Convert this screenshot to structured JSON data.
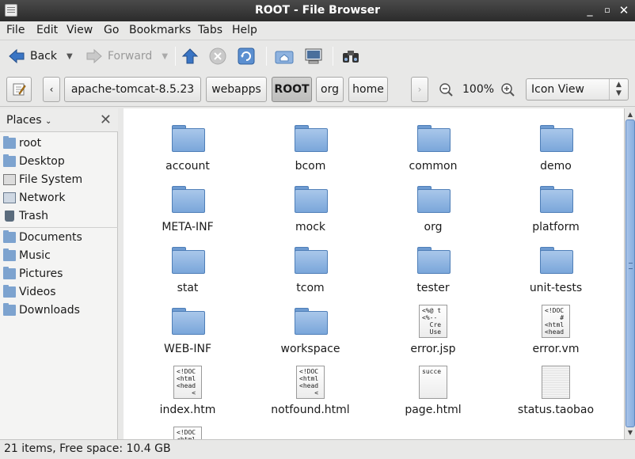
{
  "window": {
    "title": "ROOT - File Browser"
  },
  "menu": [
    "File",
    "Edit",
    "View",
    "Go",
    "Bookmarks",
    "Tabs",
    "Help"
  ],
  "toolbar": {
    "back": "Back",
    "forward": "Forward"
  },
  "path": {
    "segments": [
      "apache-tomcat-8.5.23",
      "webapps",
      "ROOT",
      "org",
      "home"
    ],
    "active": "ROOT"
  },
  "zoom": "100%",
  "view_mode": "Icon View",
  "sidebar": {
    "header": "Places",
    "items": [
      {
        "label": "root",
        "icon": "home-folder-icon"
      },
      {
        "label": "Desktop",
        "icon": "desktop-folder-icon"
      },
      {
        "label": "File System",
        "icon": "drive-icon"
      },
      {
        "label": "Network",
        "icon": "network-icon"
      },
      {
        "label": "Trash",
        "icon": "trash-icon"
      },
      {
        "label": "Documents",
        "icon": "documents-folder-icon"
      },
      {
        "label": "Music",
        "icon": "music-folder-icon"
      },
      {
        "label": "Pictures",
        "icon": "pictures-folder-icon"
      },
      {
        "label": "Videos",
        "icon": "videos-folder-icon"
      },
      {
        "label": "Downloads",
        "icon": "downloads-folder-icon"
      }
    ]
  },
  "files": [
    {
      "name": "account",
      "type": "folder"
    },
    {
      "name": "bcom",
      "type": "folder"
    },
    {
      "name": "common",
      "type": "folder"
    },
    {
      "name": "demo",
      "type": "folder"
    },
    {
      "name": "META-INF",
      "type": "folder"
    },
    {
      "name": "mock",
      "type": "folder"
    },
    {
      "name": "org",
      "type": "folder"
    },
    {
      "name": "platform",
      "type": "folder"
    },
    {
      "name": "stat",
      "type": "folder"
    },
    {
      "name": "tcom",
      "type": "folder"
    },
    {
      "name": "tester",
      "type": "folder"
    },
    {
      "name": "unit-tests",
      "type": "folder"
    },
    {
      "name": "WEB-INF",
      "type": "folder"
    },
    {
      "name": "workspace",
      "type": "folder"
    },
    {
      "name": "error.jsp",
      "type": "file",
      "preview": "<%@ t\n<%--\n  Cre\n  Use"
    },
    {
      "name": "error.vm",
      "type": "file",
      "preview": "<!DOC\n    #\n<html\n<head"
    },
    {
      "name": "index.htm",
      "type": "file",
      "preview": "<!DOC\n<html\n<head\n    <"
    },
    {
      "name": "notfound.html",
      "type": "file",
      "preview": "<!DOC\n<html\n<head\n    <"
    },
    {
      "name": "page.html",
      "type": "file",
      "preview": "succe"
    },
    {
      "name": "status.taobao",
      "type": "file",
      "preview": ""
    },
    {
      "name": "",
      "type": "file",
      "preview": "<!DOC\n<html"
    }
  ],
  "status": "21 items, Free space: 10.4 GB"
}
